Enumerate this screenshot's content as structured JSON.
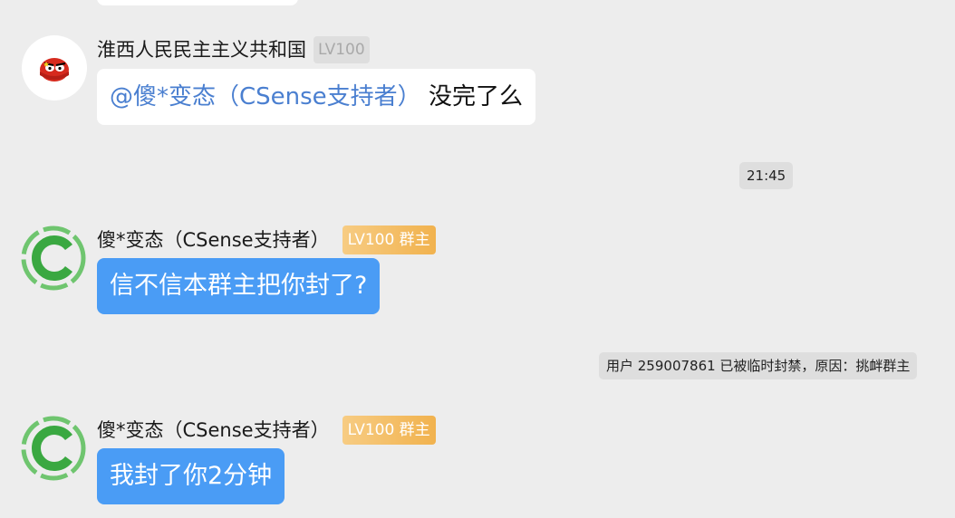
{
  "messages": [
    {
      "sender": "淮西人民民主主义共和国",
      "level": "LV100",
      "mention": "@傻*变态（CSense支持者）",
      "text": " 没完了么"
    },
    {
      "timestamp": "21:45"
    },
    {
      "sender": "傻*变态（CSense支持者）",
      "level": "LV100 群主",
      "text": "信不信本群主把你封了?"
    },
    {
      "system": "用户 259007861 已被临时封禁，原因：挑衅群主"
    },
    {
      "sender": "傻*变态（CSense支持者）",
      "level": "LV100 群主",
      "text": "我封了你2分钟"
    }
  ],
  "colors": {
    "background": "#ededed",
    "bubble_blue": "#4a9cf5",
    "mention": "#4a7fd0",
    "badge_gold": "#f1b24e",
    "avatar_green": "#3aa841",
    "avatar_red": "#d62a1e"
  }
}
